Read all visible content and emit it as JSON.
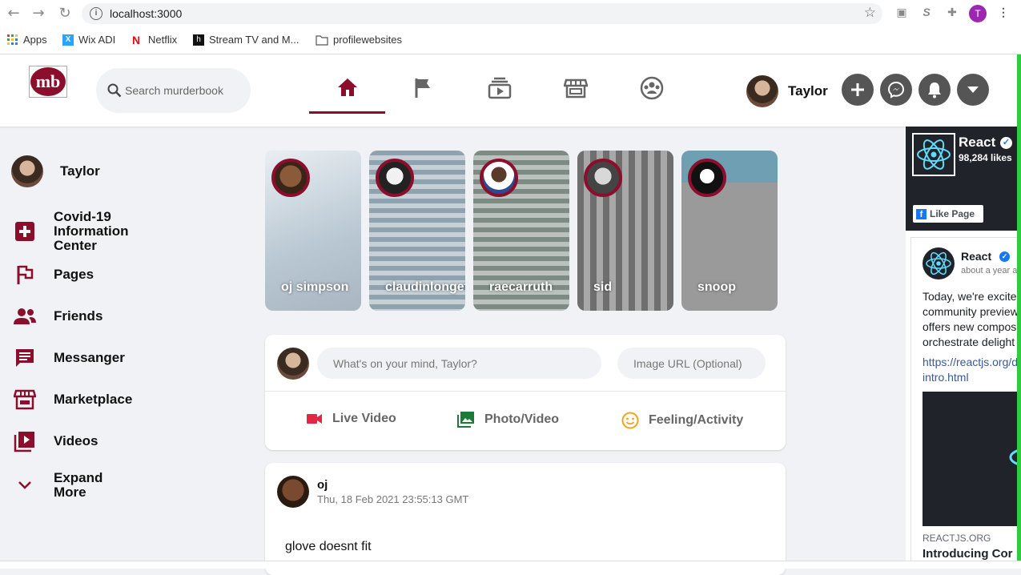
{
  "browser": {
    "url": "localhost:3000",
    "profile_initial": "T",
    "bookmarks": [
      "Apps",
      "Wix ADI",
      "Netflix",
      "Stream TV and M...",
      "profilewebsites"
    ]
  },
  "header": {
    "logo_text": "mb",
    "search_placeholder": "Search murderbook",
    "tabs": [
      "home-icon",
      "flag-icon",
      "watch-icon",
      "marketplace-icon",
      "groups-icon"
    ],
    "user_name": "Taylor",
    "accent": "#8b0e2c"
  },
  "sidebar": {
    "user_name": "Taylor",
    "items": [
      {
        "label": "Covid-19 Information Center",
        "icon": "medical-cross-icon"
      },
      {
        "label": "Pages",
        "icon": "flag-icon"
      },
      {
        "label": "Friends",
        "icon": "friends-icon"
      },
      {
        "label": "Messanger",
        "icon": "chat-icon"
      },
      {
        "label": "Marketplace",
        "icon": "store-icon"
      },
      {
        "label": "Videos",
        "icon": "video-library-icon"
      },
      {
        "label": "Expand More",
        "icon": "chevron-down-icon"
      }
    ]
  },
  "stories": [
    {
      "name": "oj simpson"
    },
    {
      "name": "claudinlonget"
    },
    {
      "name": "raecarruth"
    },
    {
      "name": "sid"
    },
    {
      "name": "snoop"
    }
  ],
  "composer": {
    "placeholder": "What's on your mind, Taylor?",
    "url_placeholder": "Image URL (Optional)",
    "actions": [
      "Live Video",
      "Photo/Video",
      "Feeling/Activity"
    ]
  },
  "post": {
    "author": "oj",
    "time": "Thu, 18 Feb 2021 23:55:13 GMT",
    "text": "glove doesnt fit"
  },
  "fb_widget": {
    "page_name": "React",
    "likes": "98,284 likes",
    "like_button": "Like Page",
    "card_name": "React",
    "card_time": "about a year a",
    "card_text": "Today, we're excite community preview offers new compos orchestrate delight",
    "card_link": "https://reactjs.org/d intro.html",
    "card_domain": "REACTJS.ORG",
    "card_title": "Introducing Cor"
  }
}
